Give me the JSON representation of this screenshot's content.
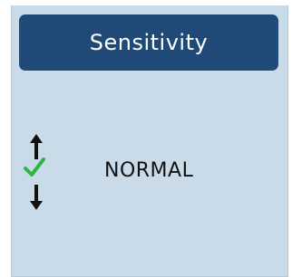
{
  "header": {
    "title": "Sensitivity"
  },
  "setting": {
    "value": "NORMAL",
    "selected_state_icon": "checkmark-icon",
    "increase_icon": "arrow-up-icon",
    "decrease_icon": "arrow-down-icon"
  },
  "colors": {
    "header_background": "#1f4a78",
    "screen_background": "#c9dbe8",
    "header_text": "#ffffff",
    "value_text": "#111111",
    "check_green": "#34b24a",
    "arrow_black": "#111111"
  }
}
